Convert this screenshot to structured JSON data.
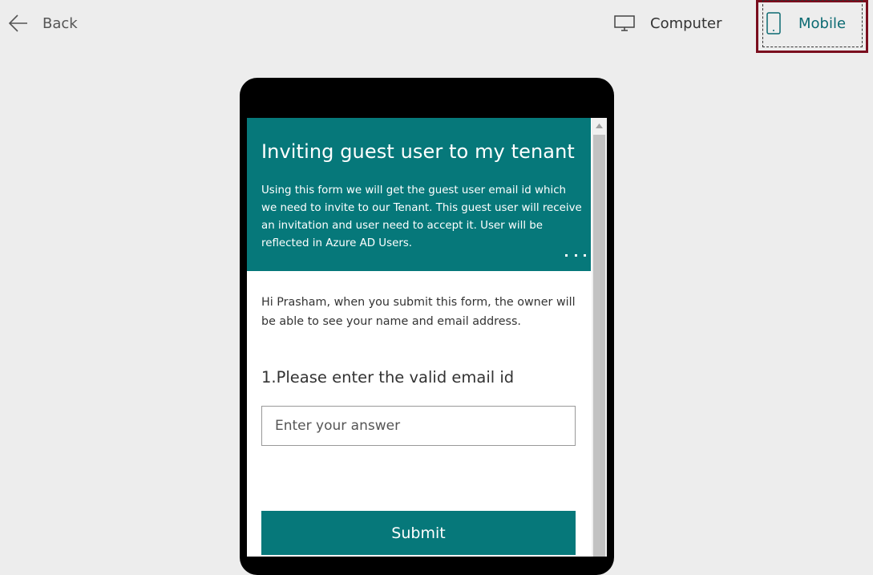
{
  "topbar": {
    "back_label": "Back",
    "computer_label": "Computer",
    "mobile_label": "Mobile",
    "selected_view": "Mobile",
    "icons": {
      "back": "arrow-left-icon",
      "computer": "monitor-icon",
      "mobile": "phone-icon"
    }
  },
  "form": {
    "title": "Inviting guest user to my tenant",
    "description": "Using this form we will get the guest user email id which we need to invite to our Tenant. This guest user will receive an invitation and user need to accept it. User will be reflected in Azure AD Users.",
    "notice": "Hi Prasham, when you submit this form, the owner will be able to see your name and email address.",
    "questions": [
      {
        "number": "1.",
        "text": "Please enter the valid email id",
        "placeholder": "Enter your answer",
        "value": ""
      }
    ],
    "submit_label": "Submit",
    "more_icon": "more-options-icon"
  },
  "colors": {
    "accent": "#06787a",
    "selected_highlight_border": "#7a0e1e",
    "background": "#ededed",
    "device_frame": "#000000"
  }
}
